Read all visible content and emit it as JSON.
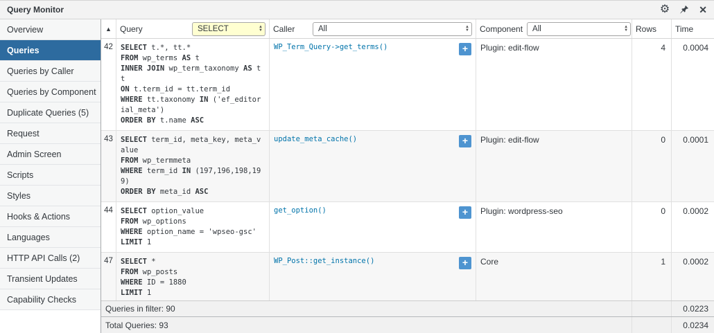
{
  "titlebar": {
    "title": "Query Monitor"
  },
  "sidebar": {
    "items": [
      {
        "label": "Overview",
        "active": false
      },
      {
        "label": "Queries",
        "active": true
      },
      {
        "label": "Queries by Caller",
        "active": false
      },
      {
        "label": "Queries by Component",
        "active": false
      },
      {
        "label": "Duplicate Queries (5)",
        "active": false
      },
      {
        "label": "Request",
        "active": false
      },
      {
        "label": "Admin Screen",
        "active": false
      },
      {
        "label": "Scripts",
        "active": false
      },
      {
        "label": "Styles",
        "active": false
      },
      {
        "label": "Hooks & Actions",
        "active": false
      },
      {
        "label": "Languages",
        "active": false
      },
      {
        "label": "HTTP API Calls (2)",
        "active": false
      },
      {
        "label": "Transient Updates",
        "active": false
      },
      {
        "label": "Capability Checks",
        "active": false
      }
    ]
  },
  "table": {
    "header": {
      "sort_indicator": "▲",
      "query_label": "Query",
      "query_filter_value": "SELECT",
      "caller_label": "Caller",
      "caller_filter_value": "All",
      "component_label": "Component",
      "component_filter_value": "All",
      "rows_label": "Rows",
      "time_label": "Time"
    },
    "sql_keywords": [
      "SELECT",
      "FROM",
      "INNER JOIN",
      "ON",
      "WHERE",
      "IN",
      "ORDER BY",
      "ASC",
      "LIMIT",
      "AS"
    ],
    "rows": [
      {
        "num": "42",
        "sql": "SELECT t.*, tt.*\nFROM wp_terms AS t\nINNER JOIN wp_term_taxonomy AS tt\nON t.term_id = tt.term_id\nWHERE tt.taxonomy IN ('ef_editorial_meta')\nORDER BY t.name ASC",
        "caller": "WP_Term_Query->get_terms()",
        "component": "Plugin: edit-flow",
        "rows": "4",
        "time": "0.0004"
      },
      {
        "num": "43",
        "sql": "SELECT term_id, meta_key, meta_value\nFROM wp_termmeta\nWHERE term_id IN (197,196,198,199)\nORDER BY meta_id ASC",
        "caller": "update_meta_cache()",
        "component": "Plugin: edit-flow",
        "rows": "0",
        "time": "0.0001"
      },
      {
        "num": "44",
        "sql": "SELECT option_value\nFROM wp_options\nWHERE option_name = 'wpseo-gsc'\nLIMIT 1",
        "caller": "get_option()",
        "component": "Plugin: wordpress-seo",
        "rows": "0",
        "time": "0.0002"
      },
      {
        "num": "47",
        "sql": "SELECT *\nFROM wp_posts\nWHERE ID = 1880\nLIMIT 1",
        "caller": "WP_Post::get_instance()",
        "component": "Core",
        "rows": "1",
        "time": "0.0002"
      }
    ],
    "footer": [
      {
        "label": "Queries in filter: 90",
        "time": "0.0223"
      },
      {
        "label": "Total Queries: 93",
        "time": "0.0234"
      }
    ]
  }
}
